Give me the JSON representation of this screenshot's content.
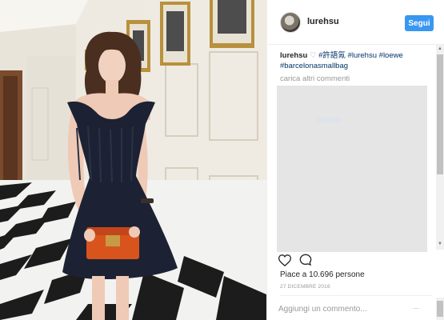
{
  "post": {
    "username": "lurehsu",
    "follow_label": "Segui",
    "caption": {
      "author": "lurehsu",
      "mark": "♡",
      "tags": [
        "#許語氝",
        "#lurehsu",
        "#loewe",
        "#barcelonasmallbag"
      ]
    },
    "load_more_label": "carica altri commenti",
    "likes_label": "Piace a 10.696 persone",
    "date_label": "27 DICEMBRE 2016",
    "comment_placeholder": "Aggiungi un commento...",
    "more_label": "⋯"
  },
  "icons": {
    "like": "heart-icon",
    "comment": "speech-bubble-icon",
    "more": "more-icon"
  },
  "colors": {
    "follow_button": "#3897f0",
    "hashtag": "#003569",
    "muted_text": "#999999",
    "bag": "#d8541c",
    "dress": "#1c2233"
  }
}
